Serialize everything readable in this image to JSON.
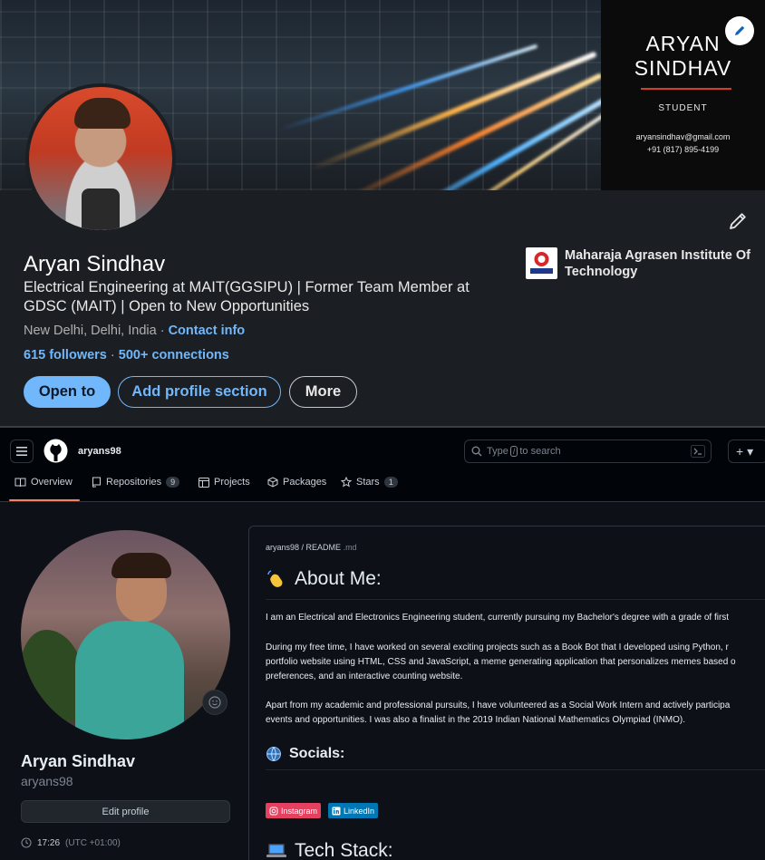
{
  "linkedin": {
    "banner_card": {
      "name_line1": "ARYAN",
      "name_line2": "SINDHAV",
      "role": "STUDENT",
      "email": "aryansindhav@gmail.com",
      "phone": "+91 (817) 895-4199"
    },
    "name": "Aryan Sindhav",
    "headline": "Electrical Engineering at MAIT(GGSIPU) | Former Team Member at GDSC (MAIT) | Open to New Opportunities",
    "location": "New Delhi, Delhi, India · ",
    "contact_info": "Contact info",
    "followers": "615 followers",
    "separator": " · ",
    "connections": "500+ connections",
    "buttons": {
      "open_to": "Open to",
      "add_section": "Add profile section",
      "more": "More"
    },
    "school": {
      "name": "Maharaja Agrasen Institute Of Technology",
      "logo_text": "MAIT"
    },
    "colors": {
      "accent": "#71b7fb",
      "card_bg": "#1b1f23"
    }
  },
  "github": {
    "header": {
      "username": "aryans98",
      "search_prefix": "Type",
      "search_key": "/",
      "search_suffix": "to search",
      "plus_label": "+ ▾"
    },
    "tabs": [
      {
        "label": "Overview",
        "icon": "book-icon"
      },
      {
        "label": "Repositories",
        "icon": "repo-icon",
        "count": "9"
      },
      {
        "label": "Projects",
        "icon": "table-icon"
      },
      {
        "label": "Packages",
        "icon": "package-icon"
      },
      {
        "label": "Stars",
        "icon": "star-icon",
        "count": "1"
      }
    ],
    "profile": {
      "name": "Aryan Sindhav",
      "login": "aryans98",
      "edit_profile": "Edit profile",
      "time": "17:26",
      "utc": "(UTC +01:00)"
    },
    "readme": {
      "path_user": "aryans98",
      "path_sep": " / ",
      "path_file": "README",
      "path_ext": " .md",
      "about_heading": "About Me:",
      "about_p1": "I am an Electrical and Electronics Engineering student, currently pursuing my Bachelor's degree with a grade of first",
      "about_p2a": "During my free time, I have worked on several exciting projects such as a Book Bot that I developed using Python, r",
      "about_p2b": "portfolio website using HTML, CSS and JavaScript, a meme generating application that personalizes memes based o",
      "about_p2c": "preferences, and an interactive counting website.",
      "about_p3a": "Apart from my academic and professional pursuits, I have volunteered as a Social Work Intern and actively participa",
      "about_p3b": "events and opportunities. I was also a finalist in the 2019 Indian National Mathematics Olympiad (INMO).",
      "socials_heading": "Socials:",
      "badge_instagram": "Instagram",
      "badge_linkedin": "LinkedIn",
      "tech_heading": "Tech Stack:"
    },
    "colors": {
      "bg": "#0d1117",
      "header_bg": "#010409",
      "tab_underline": "#f78166"
    }
  }
}
